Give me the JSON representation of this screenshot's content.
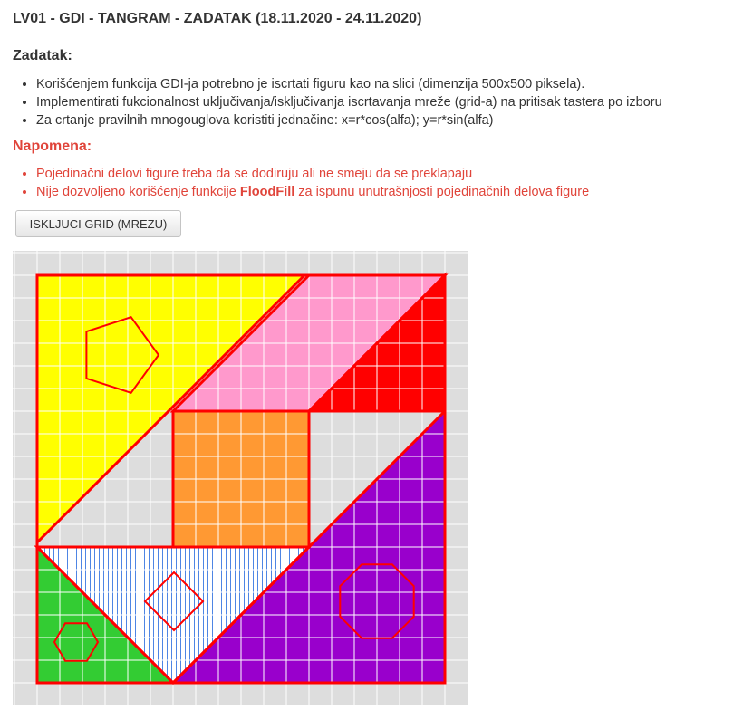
{
  "header": {
    "title": "LV01 - GDI - TANGRAM - ZADATAK (18.11.2020 - 24.11.2020)"
  },
  "task": {
    "heading": "Zadatak:",
    "items": [
      "Korišćenjem funkcija GDI-ja potrebno je iscrtati figuru kao na slici (dimenzija 500x500 piksela).",
      "Implementirati fukcionalnost uključivanja/isključivanja iscrtavanja mreže (grid-a) na pritisak tastera po izboru",
      "Za crtanje pravilnih mnogouglova koristiti jednačine: x=r*cos(alfa); y=r*sin(alfa)"
    ]
  },
  "note": {
    "heading": "Napomena:",
    "item1": "Pojedinačni delovi figure treba da se dodiruju ali ne smeju da se preklapaju",
    "item2_prefix": "Nije dozvoljeno korišćenje funkcije ",
    "item2_bold": "FloodFill",
    "item2_suffix": " za ispunu unutrašnjosti pojedinačnih delova figure"
  },
  "toolbar": {
    "grid_toggle_label": "ISKLJUCI GRID (MREZU)"
  },
  "figure": {
    "colors": {
      "background": "#dddddd",
      "grid_line": "#ffffff",
      "outline": "#ff0000",
      "yellow_triangle": "#ffff00",
      "pink_parallelogram": "#ff99cc",
      "red_triangle": "#ff0000",
      "orange_square": "#ff9933",
      "purple_triangle": "#9900cc",
      "hatched_triangle_fill": "#ffffff",
      "hatch_lines": "#2266dd",
      "green_triangle": "#33cc33"
    },
    "shapes": [
      {
        "name": "yellow-triangle",
        "polygon": "pentagon"
      },
      {
        "name": "pink-parallelogram"
      },
      {
        "name": "red-triangle"
      },
      {
        "name": "orange-square"
      },
      {
        "name": "purple-triangle",
        "polygon": "octagon"
      },
      {
        "name": "hatched-triangle",
        "polygon": "square"
      },
      {
        "name": "green-triangle",
        "polygon": "hexagon"
      }
    ]
  }
}
